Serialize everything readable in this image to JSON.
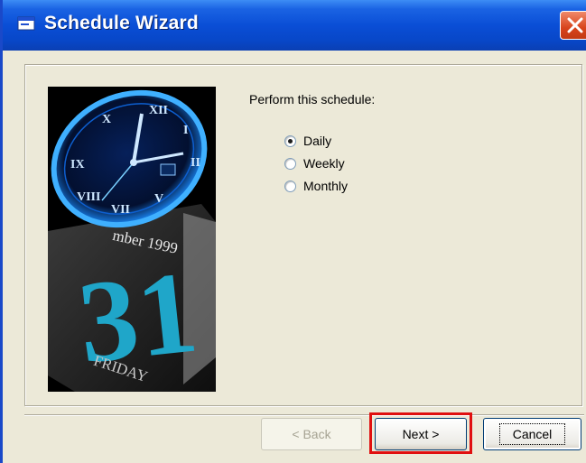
{
  "window": {
    "title": "Schedule Wizard",
    "icons": {
      "title": "window-app-icon",
      "close": "close-icon"
    }
  },
  "main": {
    "prompt": "Perform this schedule:",
    "options": [
      {
        "label": "Daily",
        "checked": true
      },
      {
        "label": "Weekly",
        "checked": false
      },
      {
        "label": "Monthly",
        "checked": false
      }
    ],
    "illustration": {
      "month_text": "mber 1999",
      "day_number": "31",
      "weekday": "FRIDAY"
    }
  },
  "buttons": {
    "back": "< Back",
    "next": "Next >",
    "cancel": "Cancel"
  },
  "colors": {
    "titlebar": "#0a4ed6",
    "highlight": "#e01010",
    "face": "#ece9d8"
  }
}
